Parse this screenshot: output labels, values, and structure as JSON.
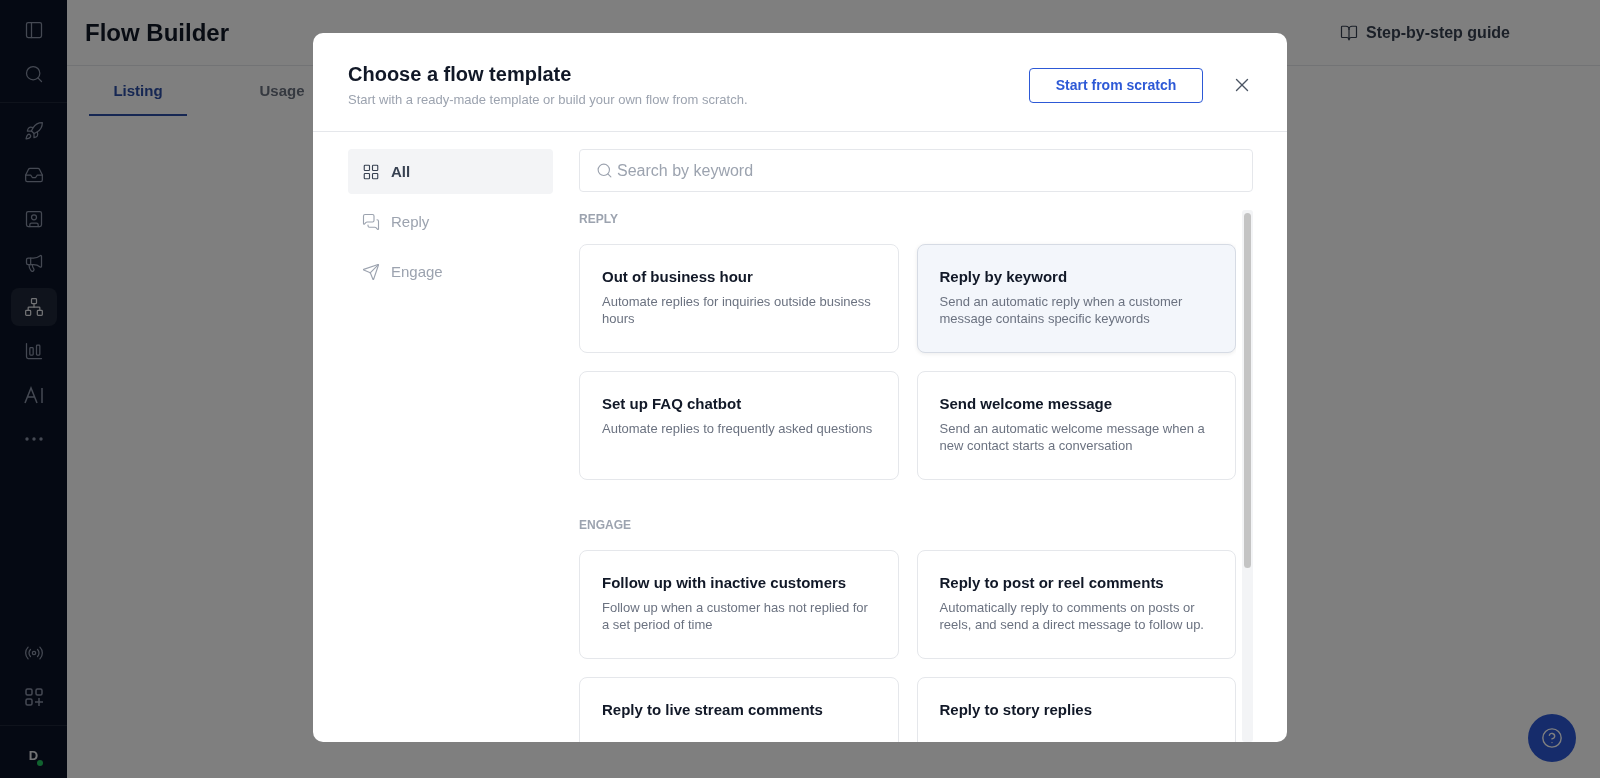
{
  "sidebar": {
    "top_items": [
      {
        "selected": false
      },
      {
        "selected": false
      }
    ],
    "items": [
      {
        "selected": false
      },
      {
        "selected": false
      },
      {
        "selected": false
      },
      {
        "selected": false
      },
      {
        "selected": true
      },
      {
        "selected": false
      },
      {
        "selected": false
      },
      {
        "selected": false
      }
    ],
    "bottom_items": [
      {
        "selected": false
      },
      {
        "selected": false
      }
    ],
    "avatar": {
      "initial": "D",
      "online": true
    }
  },
  "page": {
    "title": "Flow Builder",
    "guide_link": "Step-by-step guide",
    "tabs": [
      {
        "label": "Listing",
        "selected": true
      },
      {
        "label": "Usage",
        "selected": false
      }
    ]
  },
  "modal": {
    "title": "Choose a flow template",
    "subtitle": "Start with a ready-made template or build your own flow from scratch.",
    "primary_button": "Start from scratch",
    "categories": [
      {
        "label": "All",
        "selected": true
      },
      {
        "label": "Reply",
        "selected": false
      },
      {
        "label": "Engage",
        "selected": false
      }
    ],
    "search": {
      "placeholder": "Search by keyword"
    },
    "sections": [
      {
        "heading": "REPLY",
        "templates": [
          {
            "title": "Out of business hour",
            "description": "Automate replies for inquiries outside business hours",
            "hovered": false
          },
          {
            "title": "Reply by keyword",
            "description": "Send an automatic reply when a customer message contains specific keywords",
            "hovered": true
          },
          {
            "title": "Set up FAQ chatbot",
            "description": "Automate replies to frequently asked questions",
            "hovered": false
          },
          {
            "title": "Send welcome message",
            "description": "Send an automatic welcome message when a new contact starts a conversation",
            "hovered": false
          }
        ]
      },
      {
        "heading": "ENGAGE",
        "templates": [
          {
            "title": "Follow up with inactive customers",
            "description": "Follow up when a customer has not replied for a set period of time",
            "hovered": false
          },
          {
            "title": "Reply to post or reel comments",
            "description": "Automatically reply to comments on posts or reels, and send a direct message to follow up.",
            "hovered": false
          },
          {
            "title": "Reply to live stream comments",
            "hovered": false
          },
          {
            "title": "Reply to story replies",
            "hovered": false
          }
        ]
      }
    ]
  }
}
